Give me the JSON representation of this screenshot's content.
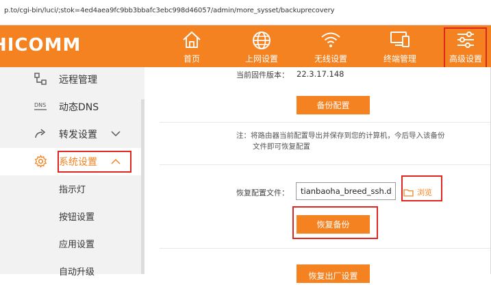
{
  "browser": {
    "url": "p.to/cgi-bin/luci/;stok=4ed4aea9fc9bb3bbafc3ebc998d46057/admin/more_sysset/backuprecovery"
  },
  "brand": {
    "name": "HICOMM"
  },
  "nav": {
    "items": [
      {
        "label": "首页",
        "icon": "home-icon"
      },
      {
        "label": "上网设置",
        "icon": "globe-icon"
      },
      {
        "label": "无线设置",
        "icon": "wifi-icon"
      },
      {
        "label": "终端管理",
        "icon": "devices-icon"
      },
      {
        "label": "高级设置",
        "icon": "sliders-icon"
      }
    ]
  },
  "sidebar": {
    "items": [
      {
        "label": "远程管理",
        "icon": "remote-icon"
      },
      {
        "label": "动态DNS",
        "icon": "dns-icon"
      },
      {
        "label": "转发设置",
        "icon": "forward-icon"
      },
      {
        "label": "系统设置",
        "icon": "gear-icon"
      },
      {
        "label": "指示灯"
      },
      {
        "label": "按钮设置"
      },
      {
        "label": "应用设置"
      },
      {
        "label": "自动升级"
      }
    ]
  },
  "main": {
    "firmware_label": "当前固件版本：",
    "firmware_value": "22.3.17.148",
    "backup_button": "备份配置",
    "note_line1": "注：将路由器当前配置导出并保存到您的计算机，今后导入该备份",
    "note_line2": "文件即可恢复配置",
    "restore_label": "恢复配置文件：",
    "restore_file": "tianbaoha_breed_ssh.dat",
    "browse_label": "浏览",
    "restore_button": "恢复备份",
    "factory_button": "恢复出厂设置"
  },
  "colors": {
    "accent": "#f58220",
    "highlight": "#e0241e"
  }
}
